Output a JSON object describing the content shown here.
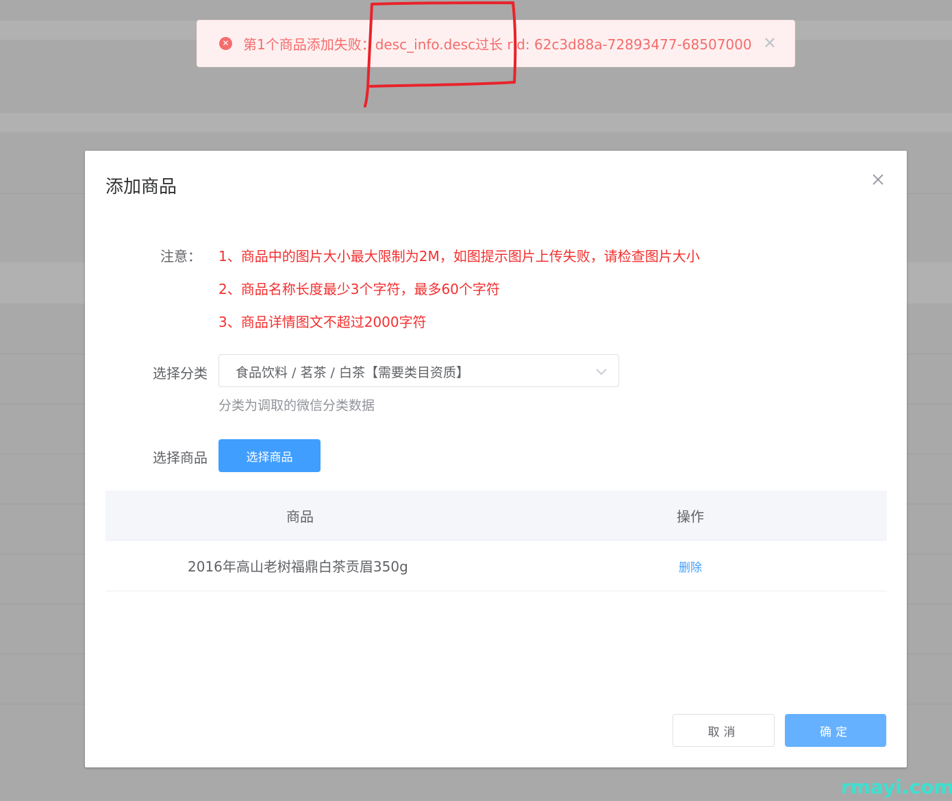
{
  "toast": {
    "icon": "error-circle-icon",
    "message": "第1个商品添加失败：desc_info.desc过长 rid: 62c3d88a-72893477-68507000",
    "close_icon": "close-icon",
    "color": "#f56c6c"
  },
  "dialog": {
    "title": "添加商品",
    "notice": {
      "label": "注意：",
      "lines": [
        "1、商品中的图片大小最大限制为2M，如图提示图片上传失败，请检查图片大小",
        "2、商品名称长度最少3个字符，最多60个字符",
        "3、商品详情图文不超过2000字符"
      ]
    },
    "category": {
      "label": "选择分类",
      "value": "食品饮料 / 茗茶 / 白茶【需要类目资质】",
      "hint": "分类为调取的微信分类数据"
    },
    "product_select": {
      "label": "选择商品",
      "button_label": "选择商品"
    },
    "table": {
      "columns": [
        "商品",
        "操作"
      ],
      "rows": [
        {
          "product": "2016年高山老树福鼎白茶贡眉350g",
          "action": "删除"
        }
      ]
    },
    "footer": {
      "cancel_label": "取消",
      "confirm_label": "确定"
    }
  },
  "watermark": "rmayi.com",
  "colors": {
    "primary": "#409eff",
    "primary_light": "#66b1ff",
    "notice_red": "#f22f2f",
    "annotation_red": "#e8232b"
  }
}
